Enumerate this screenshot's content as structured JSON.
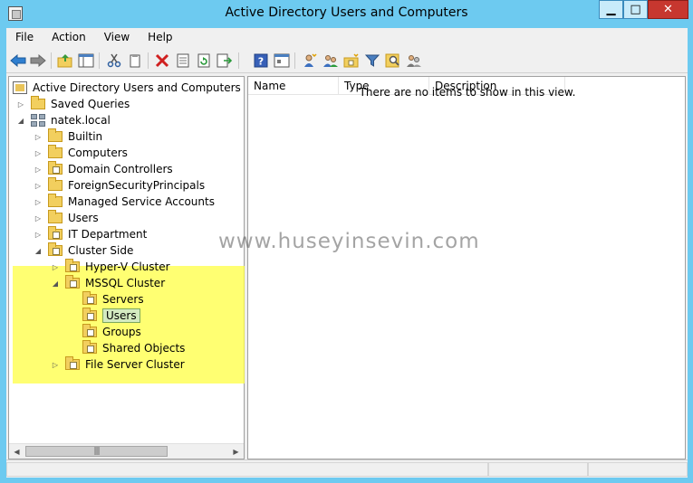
{
  "window": {
    "title": "Active Directory Users and Computers",
    "minimize_glyph": "▁",
    "maximize_glyph": "□",
    "close_glyph": "✕"
  },
  "menu": [
    "File",
    "Action",
    "View",
    "Help"
  ],
  "toolbar": {
    "icons": [
      "back-arrow-icon",
      "forward-arrow-icon",
      "up-folder-icon",
      "show-hide-tree-icon",
      "cut-icon",
      "copy-icon",
      "delete-icon",
      "properties-icon",
      "refresh-icon",
      "export-list-icon",
      "help-icon",
      "view-icon",
      "create-user-icon",
      "create-group-icon",
      "create-ou-icon",
      "filter-icon",
      "find-icon",
      "add-to-group-icon"
    ]
  },
  "tree": {
    "root": "Active Directory Users and Computers [NBR",
    "saved_queries": "Saved Queries",
    "domain": "natek.local",
    "builtin": "Builtin",
    "computers": "Computers",
    "domain_controllers": "Domain Controllers",
    "foreign_security_principals": "ForeignSecurityPrincipals",
    "managed_service_accounts": "Managed Service Accounts",
    "users": "Users",
    "it_department": "IT Department",
    "cluster_side": "Cluster Side",
    "hyperv_cluster": "Hyper-V Cluster",
    "mssql_cluster": "MSSQL Cluster",
    "servers": "Servers",
    "mssql_users": "Users",
    "groups": "Groups",
    "shared_objects": "Shared Objects",
    "file_server_cluster": "File Server Cluster",
    "expander_collapsed": "▷",
    "expander_expanded": "◢"
  },
  "list": {
    "columns": [
      "Name",
      "Type",
      "Description"
    ],
    "empty_message": "There are no items to show in this view."
  },
  "scrollbar": {
    "left_glyph": "◀",
    "right_glyph": "▶",
    "thumb_grip": "|||"
  },
  "watermark": "www.huseyinsevin.com",
  "colors": {
    "title_bar": "#6dcaf0",
    "close_button": "#c7372f",
    "highlight": "#ffff3c",
    "selected": "#d4ebc1",
    "folder": "#f2cf5e"
  }
}
